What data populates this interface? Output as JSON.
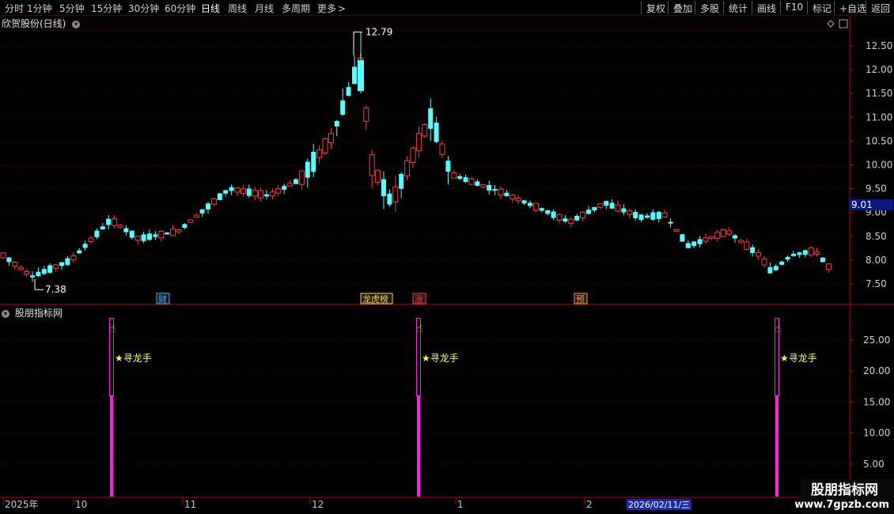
{
  "toolbar": {
    "periods": [
      "分时",
      "1分钟",
      "5分钟",
      "15分钟",
      "30分钟",
      "60分钟",
      "日线",
      "周线",
      "月线",
      "多周期",
      "更多"
    ],
    "active_period": "日线",
    "more_arrow": ">",
    "right_items": [
      "复权",
      "叠加",
      "多股",
      "统计",
      "画线",
      "F10",
      "标记",
      "+自选",
      "返回"
    ]
  },
  "main_chart": {
    "title": "欣贺股份(日线)",
    "high_label": "12.79",
    "low_label": "7.38",
    "price_label": "9.01",
    "y_ticks": [
      "12.50",
      "12.00",
      "11.50",
      "11.00",
      "10.50",
      "10.00",
      "9.50",
      "9.00",
      "8.50",
      "8.00",
      "7.50"
    ],
    "markers": [
      {
        "text": "财",
        "color": "#2bb3ff"
      },
      {
        "text": "龙虎榜",
        "color": "#ffd24a"
      },
      {
        "text": "涨",
        "color": "#ff3b3b"
      },
      {
        "text": "预",
        "color": "#ff9b3b"
      }
    ]
  },
  "indicator": {
    "title": "股朋指标网",
    "signal_label": "★寻龙手",
    "y_ticks": [
      "25.00",
      "20.00",
      "15.00",
      "10.00",
      "5.00"
    ],
    "colors": {
      "bar": "#ff1ee6",
      "signal_text": "#ffff3a"
    }
  },
  "time_axis": {
    "labels": [
      "2025年",
      "10",
      "11",
      "12",
      "1",
      "2"
    ],
    "cursor_date": "2026/02/11/三"
  },
  "watermark": {
    "title": "股朋指标网",
    "url": "www.7gpzb.com"
  },
  "colors": {
    "up": "#ff3b3b",
    "down": "#54ffff",
    "grid": "#3a0000",
    "axis": "#b30000"
  }
}
